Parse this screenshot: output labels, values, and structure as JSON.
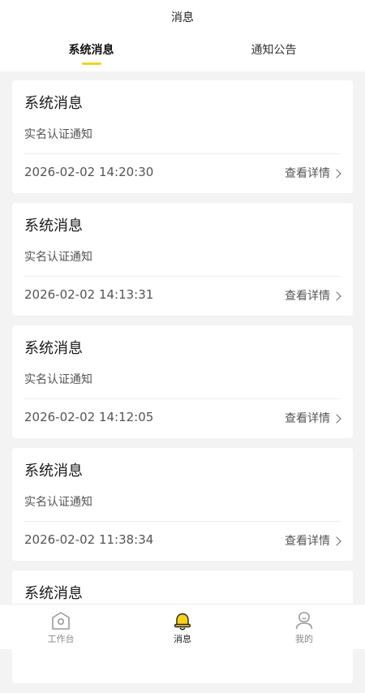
{
  "header": {
    "title": "消息"
  },
  "tabs": [
    {
      "label": "系统消息",
      "active": true
    },
    {
      "label": "通知公告",
      "active": false
    }
  ],
  "messages": [
    {
      "title": "系统消息",
      "subtitle": "实名认证通知",
      "time": "2026-02-02 14:20:30",
      "action": "查看详情"
    },
    {
      "title": "系统消息",
      "subtitle": "实名认证通知",
      "time": "2026-02-02 14:13:31",
      "action": "查看详情"
    },
    {
      "title": "系统消息",
      "subtitle": "实名认证通知",
      "time": "2026-02-02 14:12:05",
      "action": "查看详情"
    },
    {
      "title": "系统消息",
      "subtitle": "实名认证通知",
      "time": "2026-02-02 11:38:34",
      "action": "查看详情"
    },
    {
      "title": "系统消息",
      "subtitle": "",
      "time": "",
      "action": ""
    }
  ],
  "tabbar": [
    {
      "label": "工作台",
      "icon": "workbench-icon",
      "active": false
    },
    {
      "label": "消息",
      "icon": "bell-icon",
      "active": true
    },
    {
      "label": "我的",
      "icon": "profile-icon",
      "active": false
    }
  ],
  "colors": {
    "accent": "#f7d21a",
    "background": "#f3f3f3"
  }
}
